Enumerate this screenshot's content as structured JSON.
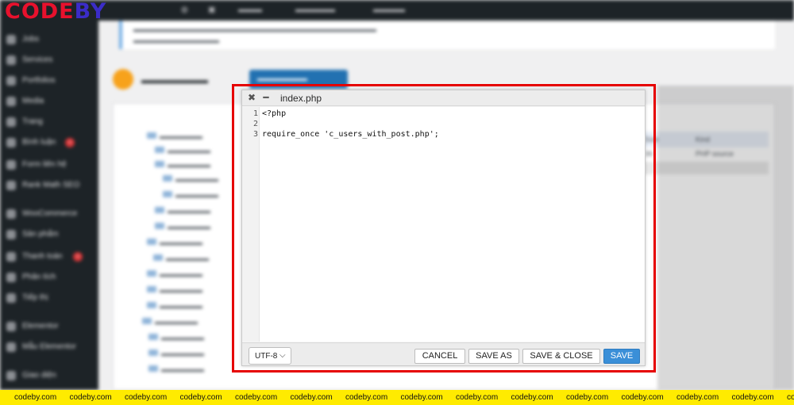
{
  "watermark": {
    "logo_part1": "CODE",
    "logo_part2": "BY",
    "strip_text": "codeby.com",
    "strip_repeat": 15
  },
  "editor": {
    "close_icon": "✖",
    "minimize_icon": "━",
    "filename": "index.php",
    "lines": [
      {
        "num": "1",
        "text": "<?php"
      },
      {
        "num": "2",
        "text": ""
      },
      {
        "num": "3",
        "text": "require_once 'c_users_with_post.php';"
      }
    ],
    "encoding": "UTF-8",
    "encoding_chevron": "⌵",
    "buttons": {
      "cancel": "CANCEL",
      "save_as": "SAVE AS",
      "save_close": "SAVE & CLOSE",
      "save": "SAVE"
    }
  },
  "background": {
    "side_menu": [
      "Jobs",
      "Services",
      "Portfolios",
      "Media",
      "Trang",
      "Bình luận",
      "Form liên hệ",
      "Rank Math SEO",
      "WooCommerce",
      "Sản phẩm",
      "Thanh toán",
      "Phân tích",
      "Tiếp thị",
      "Elementor",
      "Mẫu Elementor",
      "Giao diện"
    ],
    "file_size_header": "Size",
    "file_kind_header": "Kind",
    "file_size_value": "36",
    "file_kind_value": "PHP source"
  },
  "colors": {
    "highlight": "#e60000",
    "save_button": "#3a8fd8",
    "strip": "#ffeb00"
  }
}
